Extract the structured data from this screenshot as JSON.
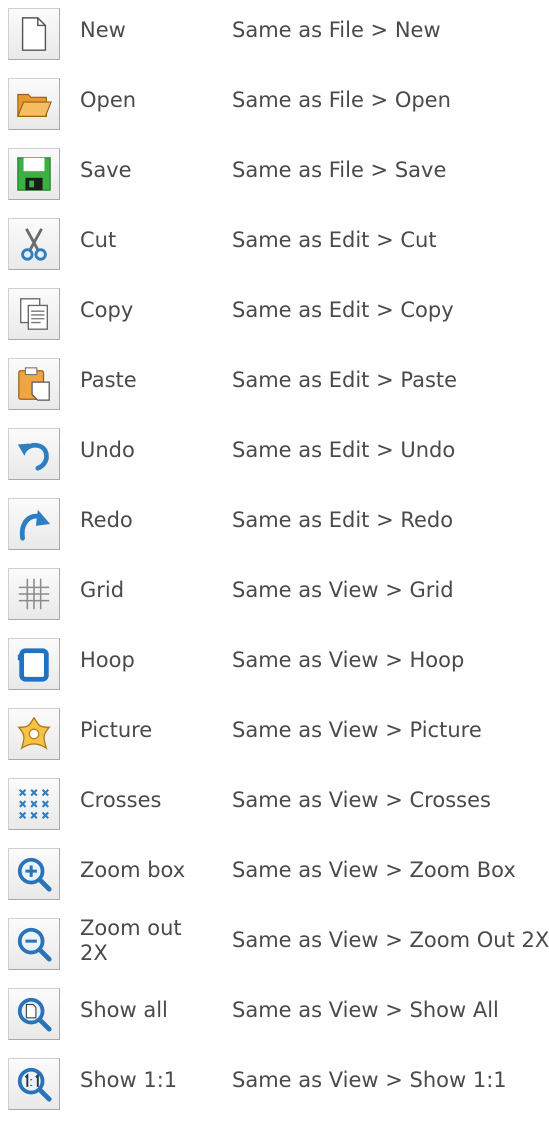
{
  "toolbar_reference": {
    "rows": [
      {
        "icon": "new-document-icon",
        "name": "New",
        "description": "Same as File > New"
      },
      {
        "icon": "open-folder-icon",
        "name": "Open",
        "description": "Same as File > Open"
      },
      {
        "icon": "save-disk-icon",
        "name": "Save",
        "description": "Same as File > Save"
      },
      {
        "icon": "scissors-icon",
        "name": "Cut",
        "description": "Same as Edit > Cut"
      },
      {
        "icon": "copy-icon",
        "name": "Copy",
        "description": "Same as Edit > Copy"
      },
      {
        "icon": "paste-icon",
        "name": "Paste",
        "description": "Same as Edit > Paste"
      },
      {
        "icon": "undo-arrow-icon",
        "name": "Undo",
        "description": "Same as Edit > Undo"
      },
      {
        "icon": "redo-arrow-icon",
        "name": "Redo",
        "description": "Same as Edit > Redo"
      },
      {
        "icon": "grid-icon",
        "name": "Grid",
        "description": "Same as View > Grid"
      },
      {
        "icon": "hoop-icon",
        "name": "Hoop",
        "description": "Same as View > Hoop"
      },
      {
        "icon": "picture-flower-icon",
        "name": "Picture",
        "description": "Same as View > Picture"
      },
      {
        "icon": "crosses-icon",
        "name": "Crosses",
        "description": "Same as View > Crosses"
      },
      {
        "icon": "zoom-box-icon",
        "name": "Zoom box",
        "description": "Same as View > Zoom Box"
      },
      {
        "icon": "zoom-out-icon",
        "name": "Zoom out 2X",
        "description": "Same as View > Zoom Out 2X"
      },
      {
        "icon": "show-all-icon",
        "name": "Show all",
        "description": "Same as View > Show All"
      },
      {
        "icon": "show-1-1-icon",
        "name": "Show 1:1",
        "description": "Same as View > Show 1:1"
      }
    ],
    "colors": {
      "text": "#4a4a4a",
      "folder": "#f0a640",
      "save_green": "#3cb043",
      "arrow_blue": "#2e7fc1",
      "zoom_blue": "#2a73b8"
    }
  }
}
